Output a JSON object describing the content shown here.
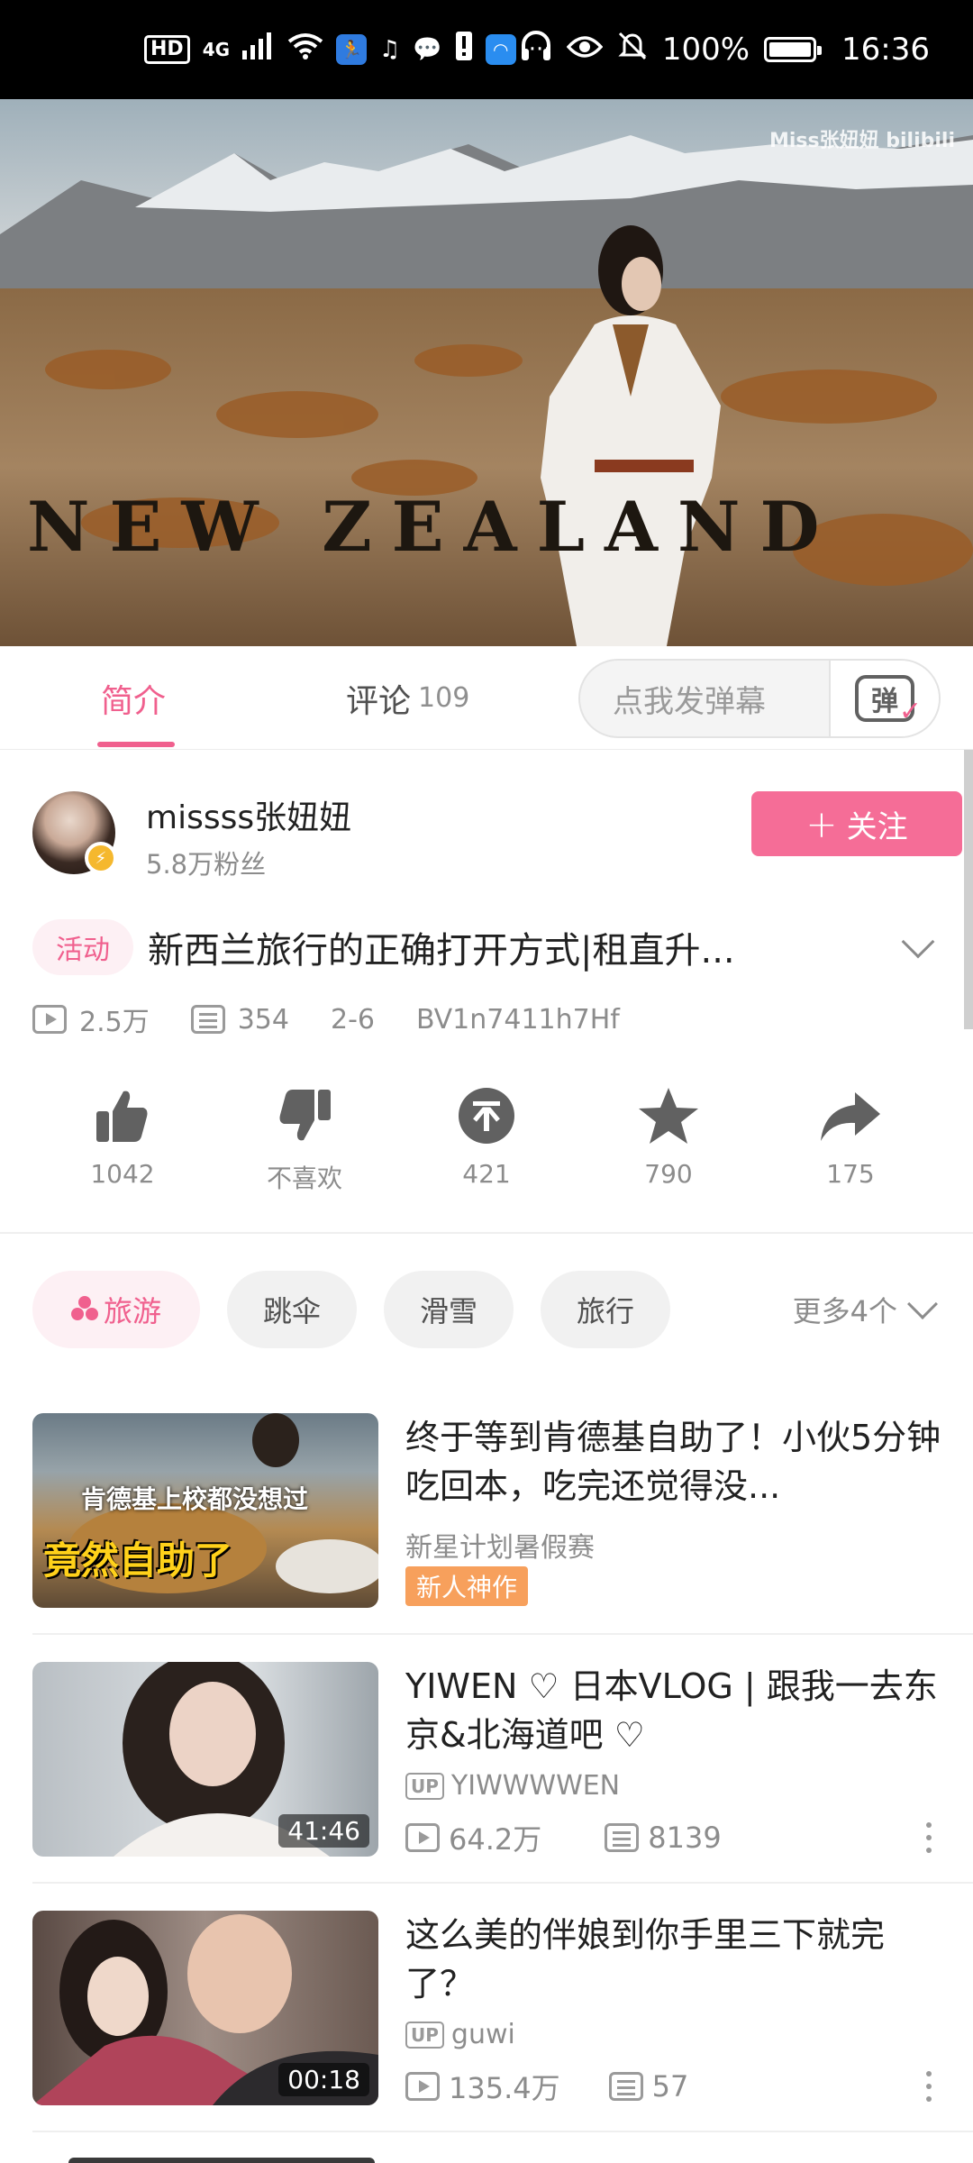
{
  "status_bar": {
    "hd": "HD",
    "network": "4G",
    "battery_percent": "100%",
    "time": "16:36",
    "more": "···"
  },
  "video": {
    "watermark": "Miss张妞妞 bilibili",
    "overlay_text": "NEW ZEALAND"
  },
  "tabs": {
    "intro_label": "简介",
    "comments_label": "评论",
    "comments_count": "109",
    "danmaku_placeholder": "点我发弹幕",
    "danmaku_icon_char": "弹"
  },
  "uploader": {
    "name": "missss张妞妞",
    "fans": "5.8万粉丝",
    "follow_label": "关注"
  },
  "title_row": {
    "activity_tag": "活动",
    "title": "新西兰旅行的正确打开方式|租直升..."
  },
  "meta": {
    "views": "2.5万",
    "danmaku_count": "354",
    "date": "2-6",
    "bvid": "BV1n7411h7Hf"
  },
  "actions": {
    "like_count": "1042",
    "dislike_label": "不喜欢",
    "coin_count": "421",
    "favorite_count": "790",
    "share_count": "175"
  },
  "tags": {
    "items": [
      "旅游",
      "跳伞",
      "滑雪",
      "旅行"
    ],
    "more_label": "更多4个"
  },
  "related": [
    {
      "title": "终于等到肯德基自助了！小伙5分钟吃回本，吃完还觉得没...",
      "subtitle": "新星计划暑假赛",
      "badge": "新人神作",
      "thumb_text_top": "肯德基上校都没想过",
      "thumb_text_bottom": "竟然自助了"
    },
    {
      "title": "YIWEN ♡ 日本VLOG | 跟我一去东京&北海道吧 ♡",
      "up_label": "UP",
      "uploader": "YIWWWWEN",
      "views": "64.2万",
      "danmaku": "8139",
      "duration": "41:46"
    },
    {
      "title": "这么美的伴娘到你手里三下就完了？",
      "up_label": "UP",
      "uploader": "guwi",
      "views": "135.4万",
      "danmaku": "57",
      "duration": "00:18"
    }
  ]
}
